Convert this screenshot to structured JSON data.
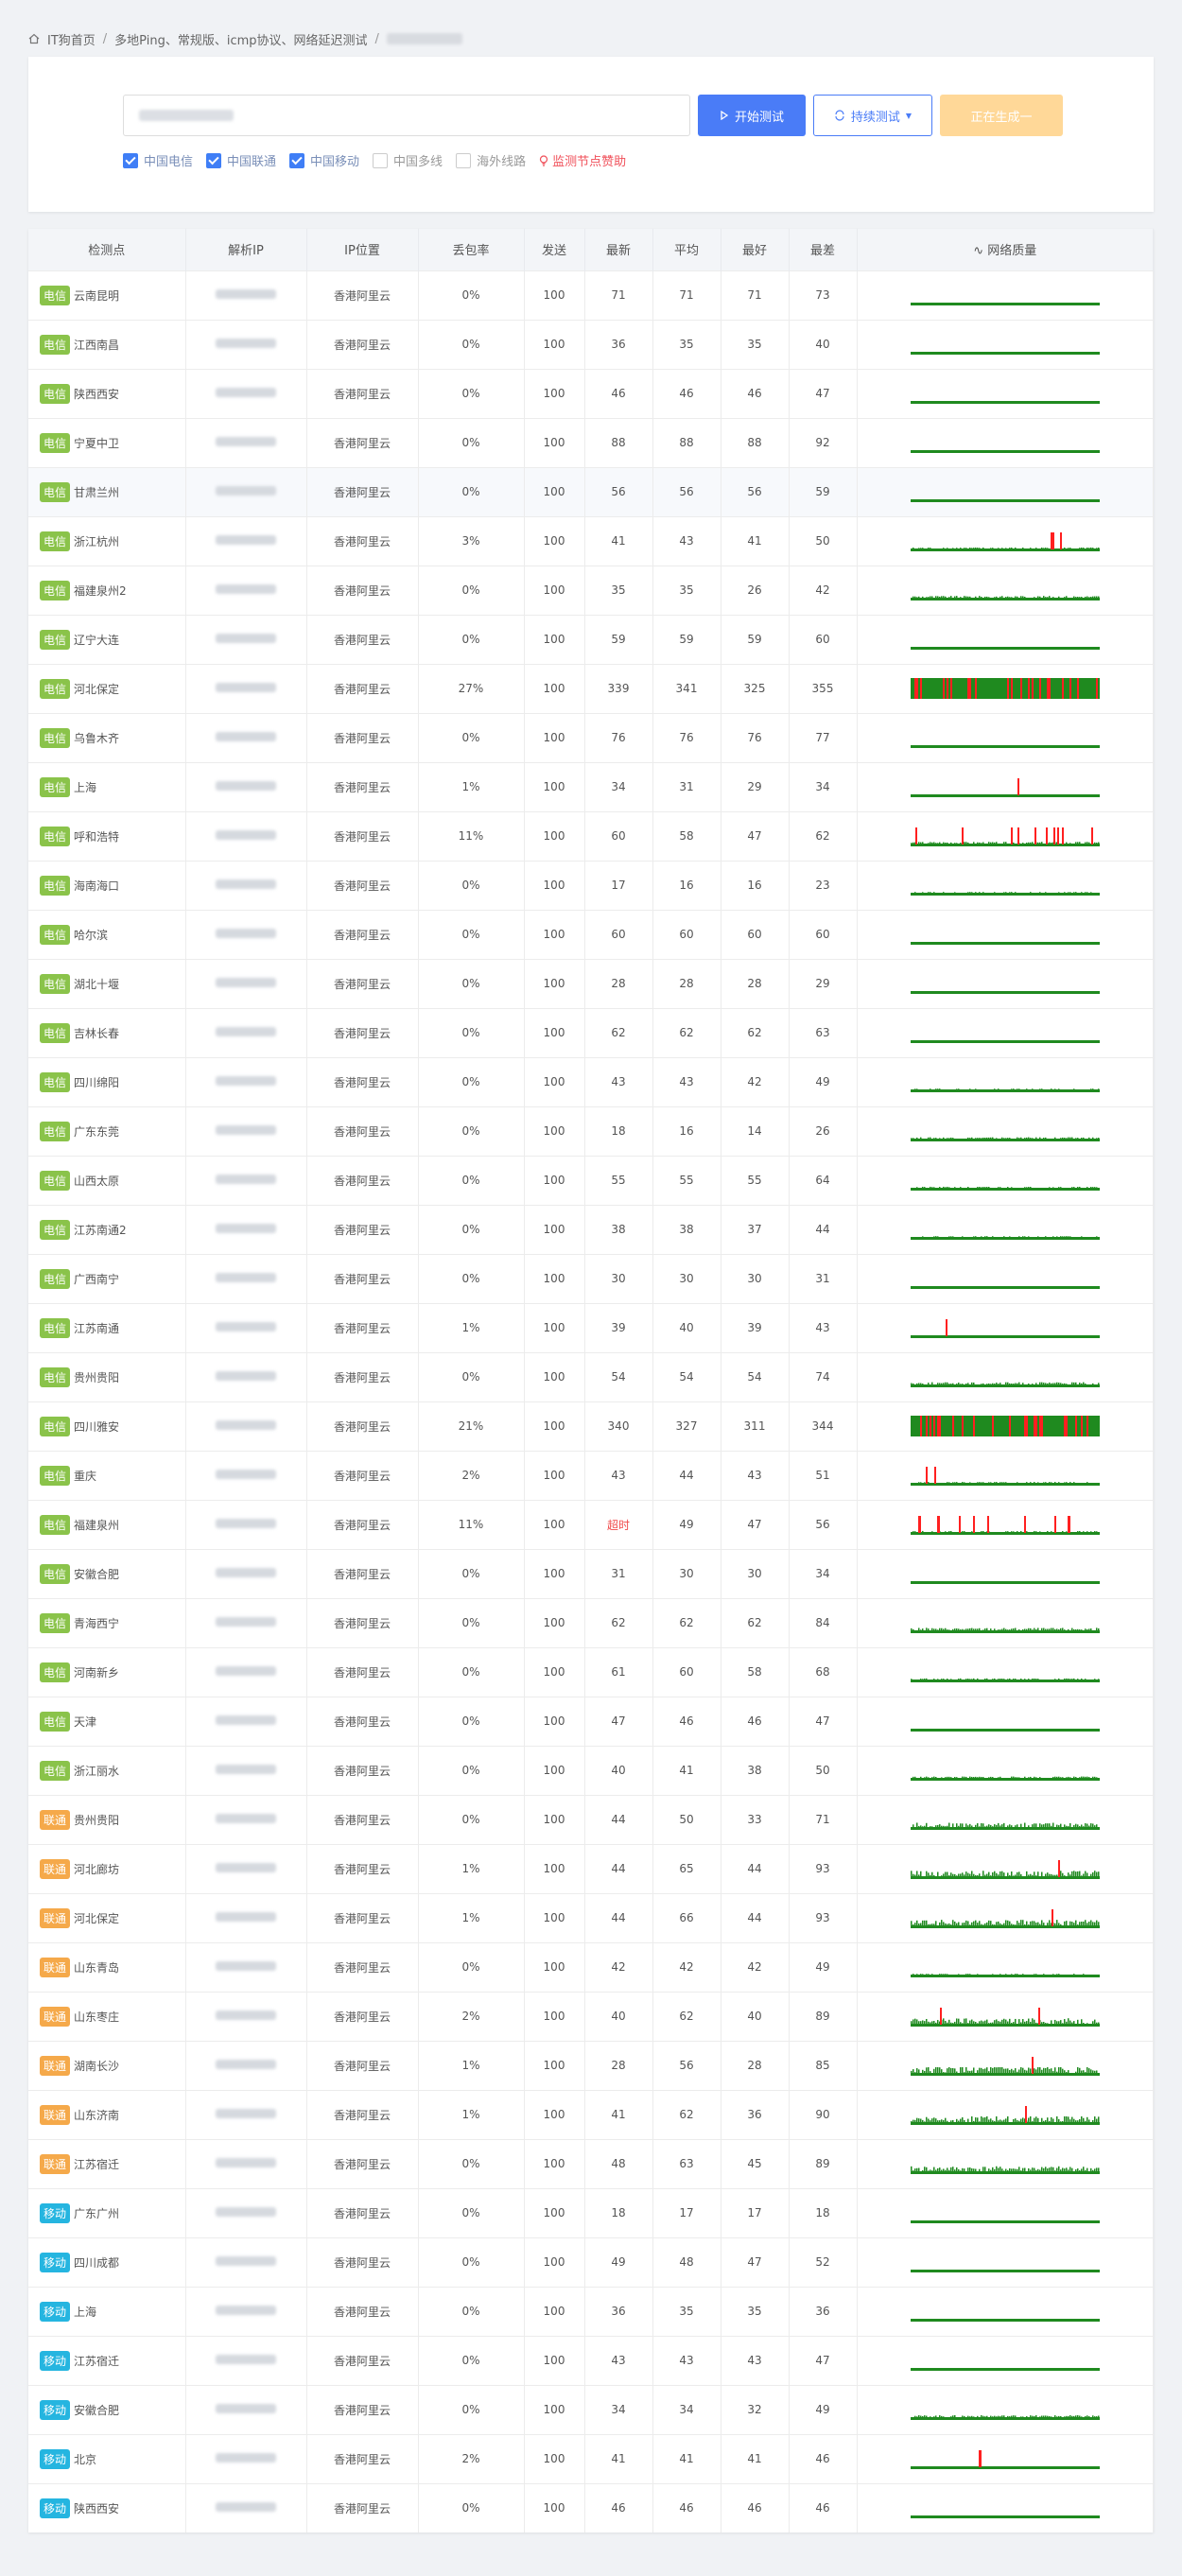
{
  "breadcrumb": {
    "home": "IT狗首页",
    "page": "多地Ping、常规版、icmp协议、网络延迟测试"
  },
  "toolbar": {
    "start_label": "开始测试",
    "loop_label": "持续测试",
    "generate_label": "正在生成一"
  },
  "filters": [
    {
      "label": "中国电信",
      "checked": true
    },
    {
      "label": "中国联通",
      "checked": true
    },
    {
      "label": "中国移动",
      "checked": true
    },
    {
      "label": "中国多线",
      "checked": false
    },
    {
      "label": "海外线路",
      "checked": false
    }
  ],
  "sponsor_label": "监测节点赞助",
  "table": {
    "headers": [
      "检测点",
      "解析IP",
      "IP位置",
      "丢包率",
      "发送",
      "最新",
      "平均",
      "最好",
      "最差",
      "网络质量"
    ],
    "rows": [
      {
        "isp": "电信",
        "node": "云南昆明",
        "loc": "香港阿里云",
        "loss": "0%",
        "sent": "100",
        "latest": "71",
        "avg": "71",
        "best": "71",
        "worst": "73"
      },
      {
        "isp": "电信",
        "node": "江西南昌",
        "loc": "香港阿里云",
        "loss": "0%",
        "sent": "100",
        "latest": "36",
        "avg": "35",
        "best": "35",
        "worst": "40"
      },
      {
        "isp": "电信",
        "node": "陕西西安",
        "loc": "香港阿里云",
        "loss": "0%",
        "sent": "100",
        "latest": "46",
        "avg": "46",
        "best": "46",
        "worst": "47"
      },
      {
        "isp": "电信",
        "node": "宁夏中卫",
        "loc": "香港阿里云",
        "loss": "0%",
        "sent": "100",
        "latest": "88",
        "avg": "88",
        "best": "88",
        "worst": "92"
      },
      {
        "isp": "电信",
        "node": "甘肃兰州",
        "loc": "香港阿里云",
        "loss": "0%",
        "sent": "100",
        "latest": "56",
        "avg": "56",
        "best": "56",
        "worst": "59"
      },
      {
        "isp": "电信",
        "node": "浙江杭州",
        "loc": "香港阿里云",
        "loss": "3%",
        "sent": "100",
        "latest": "41",
        "avg": "43",
        "best": "41",
        "worst": "50"
      },
      {
        "isp": "电信",
        "node": "福建泉州2",
        "loc": "香港阿里云",
        "loss": "0%",
        "sent": "100",
        "latest": "35",
        "avg": "35",
        "best": "26",
        "worst": "42"
      },
      {
        "isp": "电信",
        "node": "辽宁大连",
        "loc": "香港阿里云",
        "loss": "0%",
        "sent": "100",
        "latest": "59",
        "avg": "59",
        "best": "59",
        "worst": "60"
      },
      {
        "isp": "电信",
        "node": "河北保定",
        "loc": "香港阿里云",
        "loss": "27%",
        "sent": "100",
        "latest": "339",
        "avg": "341",
        "best": "325",
        "worst": "355"
      },
      {
        "isp": "电信",
        "node": "乌鲁木齐",
        "loc": "香港阿里云",
        "loss": "0%",
        "sent": "100",
        "latest": "76",
        "avg": "76",
        "best": "76",
        "worst": "77"
      },
      {
        "isp": "电信",
        "node": "上海",
        "loc": "香港阿里云",
        "loss": "1%",
        "sent": "100",
        "latest": "34",
        "avg": "31",
        "best": "29",
        "worst": "34"
      },
      {
        "isp": "电信",
        "node": "呼和浩特",
        "loc": "香港阿里云",
        "loss": "11%",
        "sent": "100",
        "latest": "60",
        "avg": "58",
        "best": "47",
        "worst": "62"
      },
      {
        "isp": "电信",
        "node": "海南海口",
        "loc": "香港阿里云",
        "loss": "0%",
        "sent": "100",
        "latest": "17",
        "avg": "16",
        "best": "16",
        "worst": "23"
      },
      {
        "isp": "电信",
        "node": "哈尔滨",
        "loc": "香港阿里云",
        "loss": "0%",
        "sent": "100",
        "latest": "60",
        "avg": "60",
        "best": "60",
        "worst": "60"
      },
      {
        "isp": "电信",
        "node": "湖北十堰",
        "loc": "香港阿里云",
        "loss": "0%",
        "sent": "100",
        "latest": "28",
        "avg": "28",
        "best": "28",
        "worst": "29"
      },
      {
        "isp": "电信",
        "node": "吉林长春",
        "loc": "香港阿里云",
        "loss": "0%",
        "sent": "100",
        "latest": "62",
        "avg": "62",
        "best": "62",
        "worst": "63"
      },
      {
        "isp": "电信",
        "node": "四川绵阳",
        "loc": "香港阿里云",
        "loss": "0%",
        "sent": "100",
        "latest": "43",
        "avg": "43",
        "best": "42",
        "worst": "49"
      },
      {
        "isp": "电信",
        "node": "广东东莞",
        "loc": "香港阿里云",
        "loss": "0%",
        "sent": "100",
        "latest": "18",
        "avg": "16",
        "best": "14",
        "worst": "26"
      },
      {
        "isp": "电信",
        "node": "山西太原",
        "loc": "香港阿里云",
        "loss": "0%",
        "sent": "100",
        "latest": "55",
        "avg": "55",
        "best": "55",
        "worst": "64"
      },
      {
        "isp": "电信",
        "node": "江苏南通2",
        "loc": "香港阿里云",
        "loss": "0%",
        "sent": "100",
        "latest": "38",
        "avg": "38",
        "best": "37",
        "worst": "44"
      },
      {
        "isp": "电信",
        "node": "广西南宁",
        "loc": "香港阿里云",
        "loss": "0%",
        "sent": "100",
        "latest": "30",
        "avg": "30",
        "best": "30",
        "worst": "31"
      },
      {
        "isp": "电信",
        "node": "江苏南通",
        "loc": "香港阿里云",
        "loss": "1%",
        "sent": "100",
        "latest": "39",
        "avg": "40",
        "best": "39",
        "worst": "43"
      },
      {
        "isp": "电信",
        "node": "贵州贵阳",
        "loc": "香港阿里云",
        "loss": "0%",
        "sent": "100",
        "latest": "54",
        "avg": "54",
        "best": "54",
        "worst": "74"
      },
      {
        "isp": "电信",
        "node": "四川雅安",
        "loc": "香港阿里云",
        "loss": "21%",
        "sent": "100",
        "latest": "340",
        "avg": "327",
        "best": "311",
        "worst": "344"
      },
      {
        "isp": "电信",
        "node": "重庆",
        "loc": "香港阿里云",
        "loss": "2%",
        "sent": "100",
        "latest": "43",
        "avg": "44",
        "best": "43",
        "worst": "51"
      },
      {
        "isp": "电信",
        "node": "福建泉州",
        "loc": "香港阿里云",
        "loss": "11%",
        "sent": "100",
        "latest": "超时",
        "avg": "49",
        "best": "47",
        "worst": "56"
      },
      {
        "isp": "电信",
        "node": "安徽合肥",
        "loc": "香港阿里云",
        "loss": "0%",
        "sent": "100",
        "latest": "31",
        "avg": "30",
        "best": "30",
        "worst": "34"
      },
      {
        "isp": "电信",
        "node": "青海西宁",
        "loc": "香港阿里云",
        "loss": "0%",
        "sent": "100",
        "latest": "62",
        "avg": "62",
        "best": "62",
        "worst": "84"
      },
      {
        "isp": "电信",
        "node": "河南新乡",
        "loc": "香港阿里云",
        "loss": "0%",
        "sent": "100",
        "latest": "61",
        "avg": "60",
        "best": "58",
        "worst": "68"
      },
      {
        "isp": "电信",
        "node": "天津",
        "loc": "香港阿里云",
        "loss": "0%",
        "sent": "100",
        "latest": "47",
        "avg": "46",
        "best": "46",
        "worst": "47"
      },
      {
        "isp": "电信",
        "node": "浙江丽水",
        "loc": "香港阿里云",
        "loss": "0%",
        "sent": "100",
        "latest": "40",
        "avg": "41",
        "best": "38",
        "worst": "50"
      },
      {
        "isp": "联通",
        "node": "贵州贵阳",
        "loc": "香港阿里云",
        "loss": "0%",
        "sent": "100",
        "latest": "44",
        "avg": "50",
        "best": "33",
        "worst": "71"
      },
      {
        "isp": "联通",
        "node": "河北廊坊",
        "loc": "香港阿里云",
        "loss": "1%",
        "sent": "100",
        "latest": "44",
        "avg": "65",
        "best": "44",
        "worst": "93"
      },
      {
        "isp": "联通",
        "node": "河北保定",
        "loc": "香港阿里云",
        "loss": "1%",
        "sent": "100",
        "latest": "44",
        "avg": "66",
        "best": "44",
        "worst": "93"
      },
      {
        "isp": "联通",
        "node": "山东青岛",
        "loc": "香港阿里云",
        "loss": "0%",
        "sent": "100",
        "latest": "42",
        "avg": "42",
        "best": "42",
        "worst": "49"
      },
      {
        "isp": "联通",
        "node": "山东枣庄",
        "loc": "香港阿里云",
        "loss": "2%",
        "sent": "100",
        "latest": "40",
        "avg": "62",
        "best": "40",
        "worst": "89"
      },
      {
        "isp": "联通",
        "node": "湖南长沙",
        "loc": "香港阿里云",
        "loss": "1%",
        "sent": "100",
        "latest": "28",
        "avg": "56",
        "best": "28",
        "worst": "85"
      },
      {
        "isp": "联通",
        "node": "山东济南",
        "loc": "香港阿里云",
        "loss": "1%",
        "sent": "100",
        "latest": "41",
        "avg": "62",
        "best": "36",
        "worst": "90"
      },
      {
        "isp": "联通",
        "node": "江苏宿迁",
        "loc": "香港阿里云",
        "loss": "0%",
        "sent": "100",
        "latest": "48",
        "avg": "63",
        "best": "45",
        "worst": "89"
      },
      {
        "isp": "移动",
        "node": "广东广州",
        "loc": "香港阿里云",
        "loss": "0%",
        "sent": "100",
        "latest": "18",
        "avg": "17",
        "best": "17",
        "worst": "18"
      },
      {
        "isp": "移动",
        "node": "四川成都",
        "loc": "香港阿里云",
        "loss": "0%",
        "sent": "100",
        "latest": "49",
        "avg": "48",
        "best": "47",
        "worst": "52"
      },
      {
        "isp": "移动",
        "node": "上海",
        "loc": "香港阿里云",
        "loss": "0%",
        "sent": "100",
        "latest": "36",
        "avg": "35",
        "best": "35",
        "worst": "36"
      },
      {
        "isp": "移动",
        "node": "江苏宿迁",
        "loc": "香港阿里云",
        "loss": "0%",
        "sent": "100",
        "latest": "43",
        "avg": "43",
        "best": "43",
        "worst": "47"
      },
      {
        "isp": "移动",
        "node": "安徽合肥",
        "loc": "香港阿里云",
        "loss": "0%",
        "sent": "100",
        "latest": "34",
        "avg": "34",
        "best": "32",
        "worst": "49"
      },
      {
        "isp": "移动",
        "node": "北京",
        "loc": "香港阿里云",
        "loss": "2%",
        "sent": "100",
        "latest": "41",
        "avg": "41",
        "best": "41",
        "worst": "46"
      },
      {
        "isp": "移动",
        "node": "陕西西安",
        "loc": "香港阿里云",
        "loss": "0%",
        "sent": "100",
        "latest": "46",
        "avg": "46",
        "best": "46",
        "worst": "46"
      }
    ]
  },
  "colors": {
    "telecom_tag": "#8ac34a",
    "unicom_tag": "#f5a94a",
    "mobile_tag": "#25b5e0",
    "good_line": "#1f8a1f",
    "loss_spike": "#ff2020",
    "primary": "#4a7cf7"
  }
}
